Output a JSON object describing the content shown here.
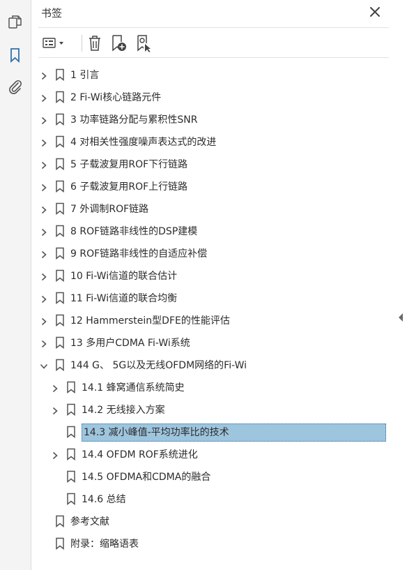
{
  "panel": {
    "title": "书签",
    "close_icon": "close-icon"
  },
  "left_rail": {
    "icons": [
      "pages-icon",
      "bookmark-icon",
      "attachment-icon"
    ]
  },
  "toolbar": {
    "icons": [
      "options-menu-icon",
      "delete-icon",
      "add-bookmark-icon",
      "bookmark-properties-icon"
    ]
  },
  "colors": {
    "selected_bg": "#9ec5de",
    "selected_border": "#2f6f99",
    "accent_bookmark": "#2f6fab"
  },
  "bookmarks": [
    {
      "label": "1 引言"
    },
    {
      "label": "2 Fi-Wi核心链路元件"
    },
    {
      "label": "3 功率链路分配与累积性SNR"
    },
    {
      "label": "4 对相关性强度噪声表达式的改进"
    },
    {
      "label": "5 子载波复用ROF下行链路"
    },
    {
      "label": "6 子载波复用ROF上行链路"
    },
    {
      "label": "7 外调制ROF链路"
    },
    {
      "label": "8 ROF链路非线性的DSP建模"
    },
    {
      "label": "9 ROF链路非线性的自适应补偿"
    },
    {
      "label": "10 Fi-Wi信道的联合估计"
    },
    {
      "label": "11 Fi-Wi信道的联合均衡"
    },
    {
      "label": "12 Hammerstein型DFE的性能评估"
    },
    {
      "label": "13 多用户CDMA Fi-Wi系统"
    },
    {
      "label": "144 G、 5G以及无线OFDM网络的Fi-Wi"
    },
    {
      "label": "14.1 蜂窝通信系统简史"
    },
    {
      "label": "14.2 无线接入方案"
    },
    {
      "label": "14.3 减小峰值-平均功率比的技术"
    },
    {
      "label": "14.4 OFDM ROF系统进化"
    },
    {
      "label": "14.5 OFDMA和CDMA的融合"
    },
    {
      "label": "14.6 总结"
    },
    {
      "label": "参考文献"
    },
    {
      "label": "附录：缩略语表"
    }
  ]
}
